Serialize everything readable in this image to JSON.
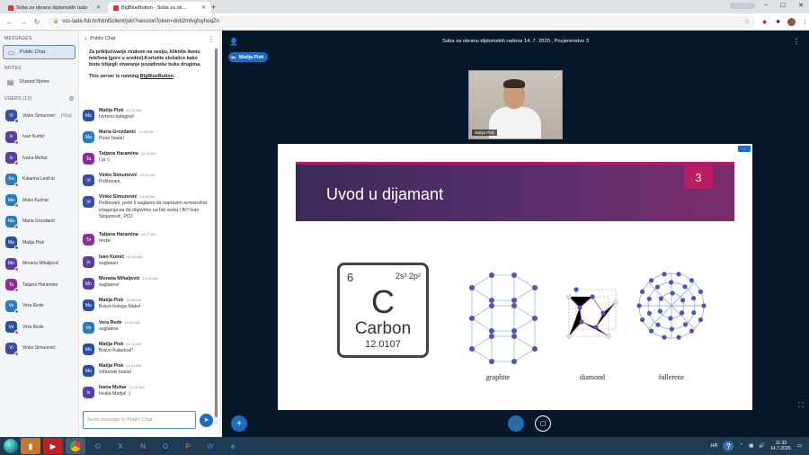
{
  "browser": {
    "tabs": [
      {
        "title": "Soba za obranu diplomskih rado",
        "active": false
      },
      {
        "title": "BigBlueButton - Soba za ob...",
        "active": true
      }
    ],
    "url": "vss-lada.fsb.hr/html5client/join?sessionToken=dnb2mfvgfsyhoqZn"
  },
  "sidebar": {
    "messages_title": "MESSAGES",
    "public_chat": "Public Chat",
    "notes_title": "NOTES",
    "shared_notes": "Shared Notes",
    "users_title": "USERS (12)",
    "users": [
      {
        "initials": "Vi",
        "name": "Vinko Simunović",
        "suffix": "(You)",
        "color": "#3b4fa0",
        "dot": "blue"
      },
      {
        "initials": "Iv",
        "name": "Ivan Kumić",
        "suffix": "",
        "color": "#5a3fa0",
        "dot": "red"
      },
      {
        "initials": "Iv",
        "name": "Ivana Muhar",
        "suffix": "",
        "color": "#5a3fa0",
        "dot": "red"
      },
      {
        "initials": "Ka",
        "name": "Katarina Lesičar",
        "suffix": "",
        "color": "#2e7bb8",
        "dot": "red"
      },
      {
        "initials": "Ma",
        "name": "Maks Kužnar",
        "suffix": "",
        "color": "#2e7bb8",
        "dot": "red"
      },
      {
        "initials": "Ma",
        "name": "Maria Grozdanić",
        "suffix": "",
        "color": "#2e7bb8",
        "dot": "red"
      },
      {
        "initials": "Ma",
        "name": "Matija Pisk",
        "suffix": "",
        "color": "#2e4fa0",
        "dot": "blue"
      },
      {
        "initials": "Mo",
        "name": "Morana Mihaljević",
        "suffix": "",
        "color": "#5a3fa0",
        "dot": "red"
      },
      {
        "initials": "Ta",
        "name": "Tatjana Haramina",
        "suffix": "",
        "color": "#8a2f9a",
        "dot": "red"
      },
      {
        "initials": "Ve",
        "name": "Vera Rede",
        "suffix": "",
        "color": "#2e7bb8",
        "dot": "red"
      },
      {
        "initials": "Ve",
        "name": "Vera Rede",
        "suffix": "",
        "color": "#2e4fa0",
        "dot": "red"
      },
      {
        "initials": "Vi",
        "name": "Vinko Simunović",
        "suffix": "",
        "color": "#3b4fa0",
        "dot": "red"
      }
    ]
  },
  "chat": {
    "header": "Public Chat",
    "welcome": "Za priključivanje zvukom na sesiju, kliknite ikonu telefona (gore u sredini).Koristite slušalice kako biste izbjegli stvaranje pozadinske buke drugima.",
    "server_prefix": "This server is running ",
    "server_link": "BigBlueButton",
    "server_suffix": ".",
    "messages": [
      {
        "initials": "Ma",
        "color": "#2e4fa0",
        "name": "Matija Pisk",
        "time": "10:12 AM",
        "text": "Izvrsno kolegice!"
      },
      {
        "initials": "Ma",
        "color": "#2e7bb8",
        "name": "Maria Grozdanić",
        "time": "10:25 AM",
        "text": "Puno hvala!"
      },
      {
        "initials": "Ta",
        "color": "#8a2f9a",
        "name": "Tatjana Haramina",
        "time": "10:25 AM",
        "text": "I ja :)"
      },
      {
        "initials": "Vi",
        "color": "#3b4fa0",
        "name": "Vinko Simunović",
        "time": "10:25 AM",
        "text": "Poštovani,"
      },
      {
        "initials": "Vi",
        "color": "#3b4fa0",
        "name": "Vinko Simunović",
        "time": "10:26 AM",
        "text": "Poštovani, jeste li suglasni da napravim screenshot izlaganja pa da objavimo na fsb webu i fb? Ivan Stojanović, POJ"
      },
      {
        "initials": "Ta",
        "color": "#8a2f9a",
        "name": "Tatjana Haramina",
        "time": "10:27 AM",
        "text": "može"
      },
      {
        "initials": "Iv",
        "color": "#5a3fa0",
        "name": "Ivan Kumić",
        "time": "10:28 AM",
        "text": "suglasan"
      },
      {
        "initials": "Mo",
        "color": "#5a3fa0",
        "name": "Morana Mihaljević",
        "time": "10:28 AM",
        "text": "suglasna!"
      },
      {
        "initials": "Ma",
        "color": "#2e4fa0",
        "name": "Matija Pisk",
        "time": "10:35 AM",
        "text": "Bravo kolega Maks!"
      },
      {
        "initials": "Ve",
        "color": "#2e7bb8",
        "name": "Vera Rede",
        "time": "10:46 AM",
        "text": "suglasna"
      },
      {
        "initials": "Ma",
        "color": "#2e4fa0",
        "name": "Matija Pisk",
        "time": "11:03 AM",
        "text": "Bravo Katarina!!"
      },
      {
        "initials": "Ma",
        "color": "#2e4fa0",
        "name": "Matija Pisk",
        "time": "11:23 AM",
        "text": "Vrhunski Ivana!"
      },
      {
        "initials": "Iv",
        "color": "#5a3fa0",
        "name": "Ivana Muhar",
        "time": "11:32 AM",
        "text": "Hvala Matija! :)"
      }
    ],
    "input_placeholder": "Send message to Public Chat"
  },
  "meeting": {
    "title": "Soba za obranu diplomskih radova 14. 7. 2020., Povjerenstvo 3",
    "presenter": "Matija Pisk",
    "presenter_initials": "Ma",
    "webcam_label": "Matija Pisk"
  },
  "slide": {
    "title": "Uvod u dijamant",
    "number": "3",
    "element": {
      "atomic_number": "6",
      "config": "2s² 2p²",
      "symbol": "C",
      "name": "Carbon",
      "mass": "12.0107"
    },
    "captions": {
      "graphite": "graphite",
      "diamond": "diamond",
      "fullerene": "fullerene"
    }
  },
  "taskbar": {
    "language": "HR",
    "time": "11:33",
    "date": "14.7.2020."
  },
  "colors": {
    "accent": "#1b6dbf",
    "main_bg": "#06172a",
    "slide_number": "#b81c63"
  }
}
